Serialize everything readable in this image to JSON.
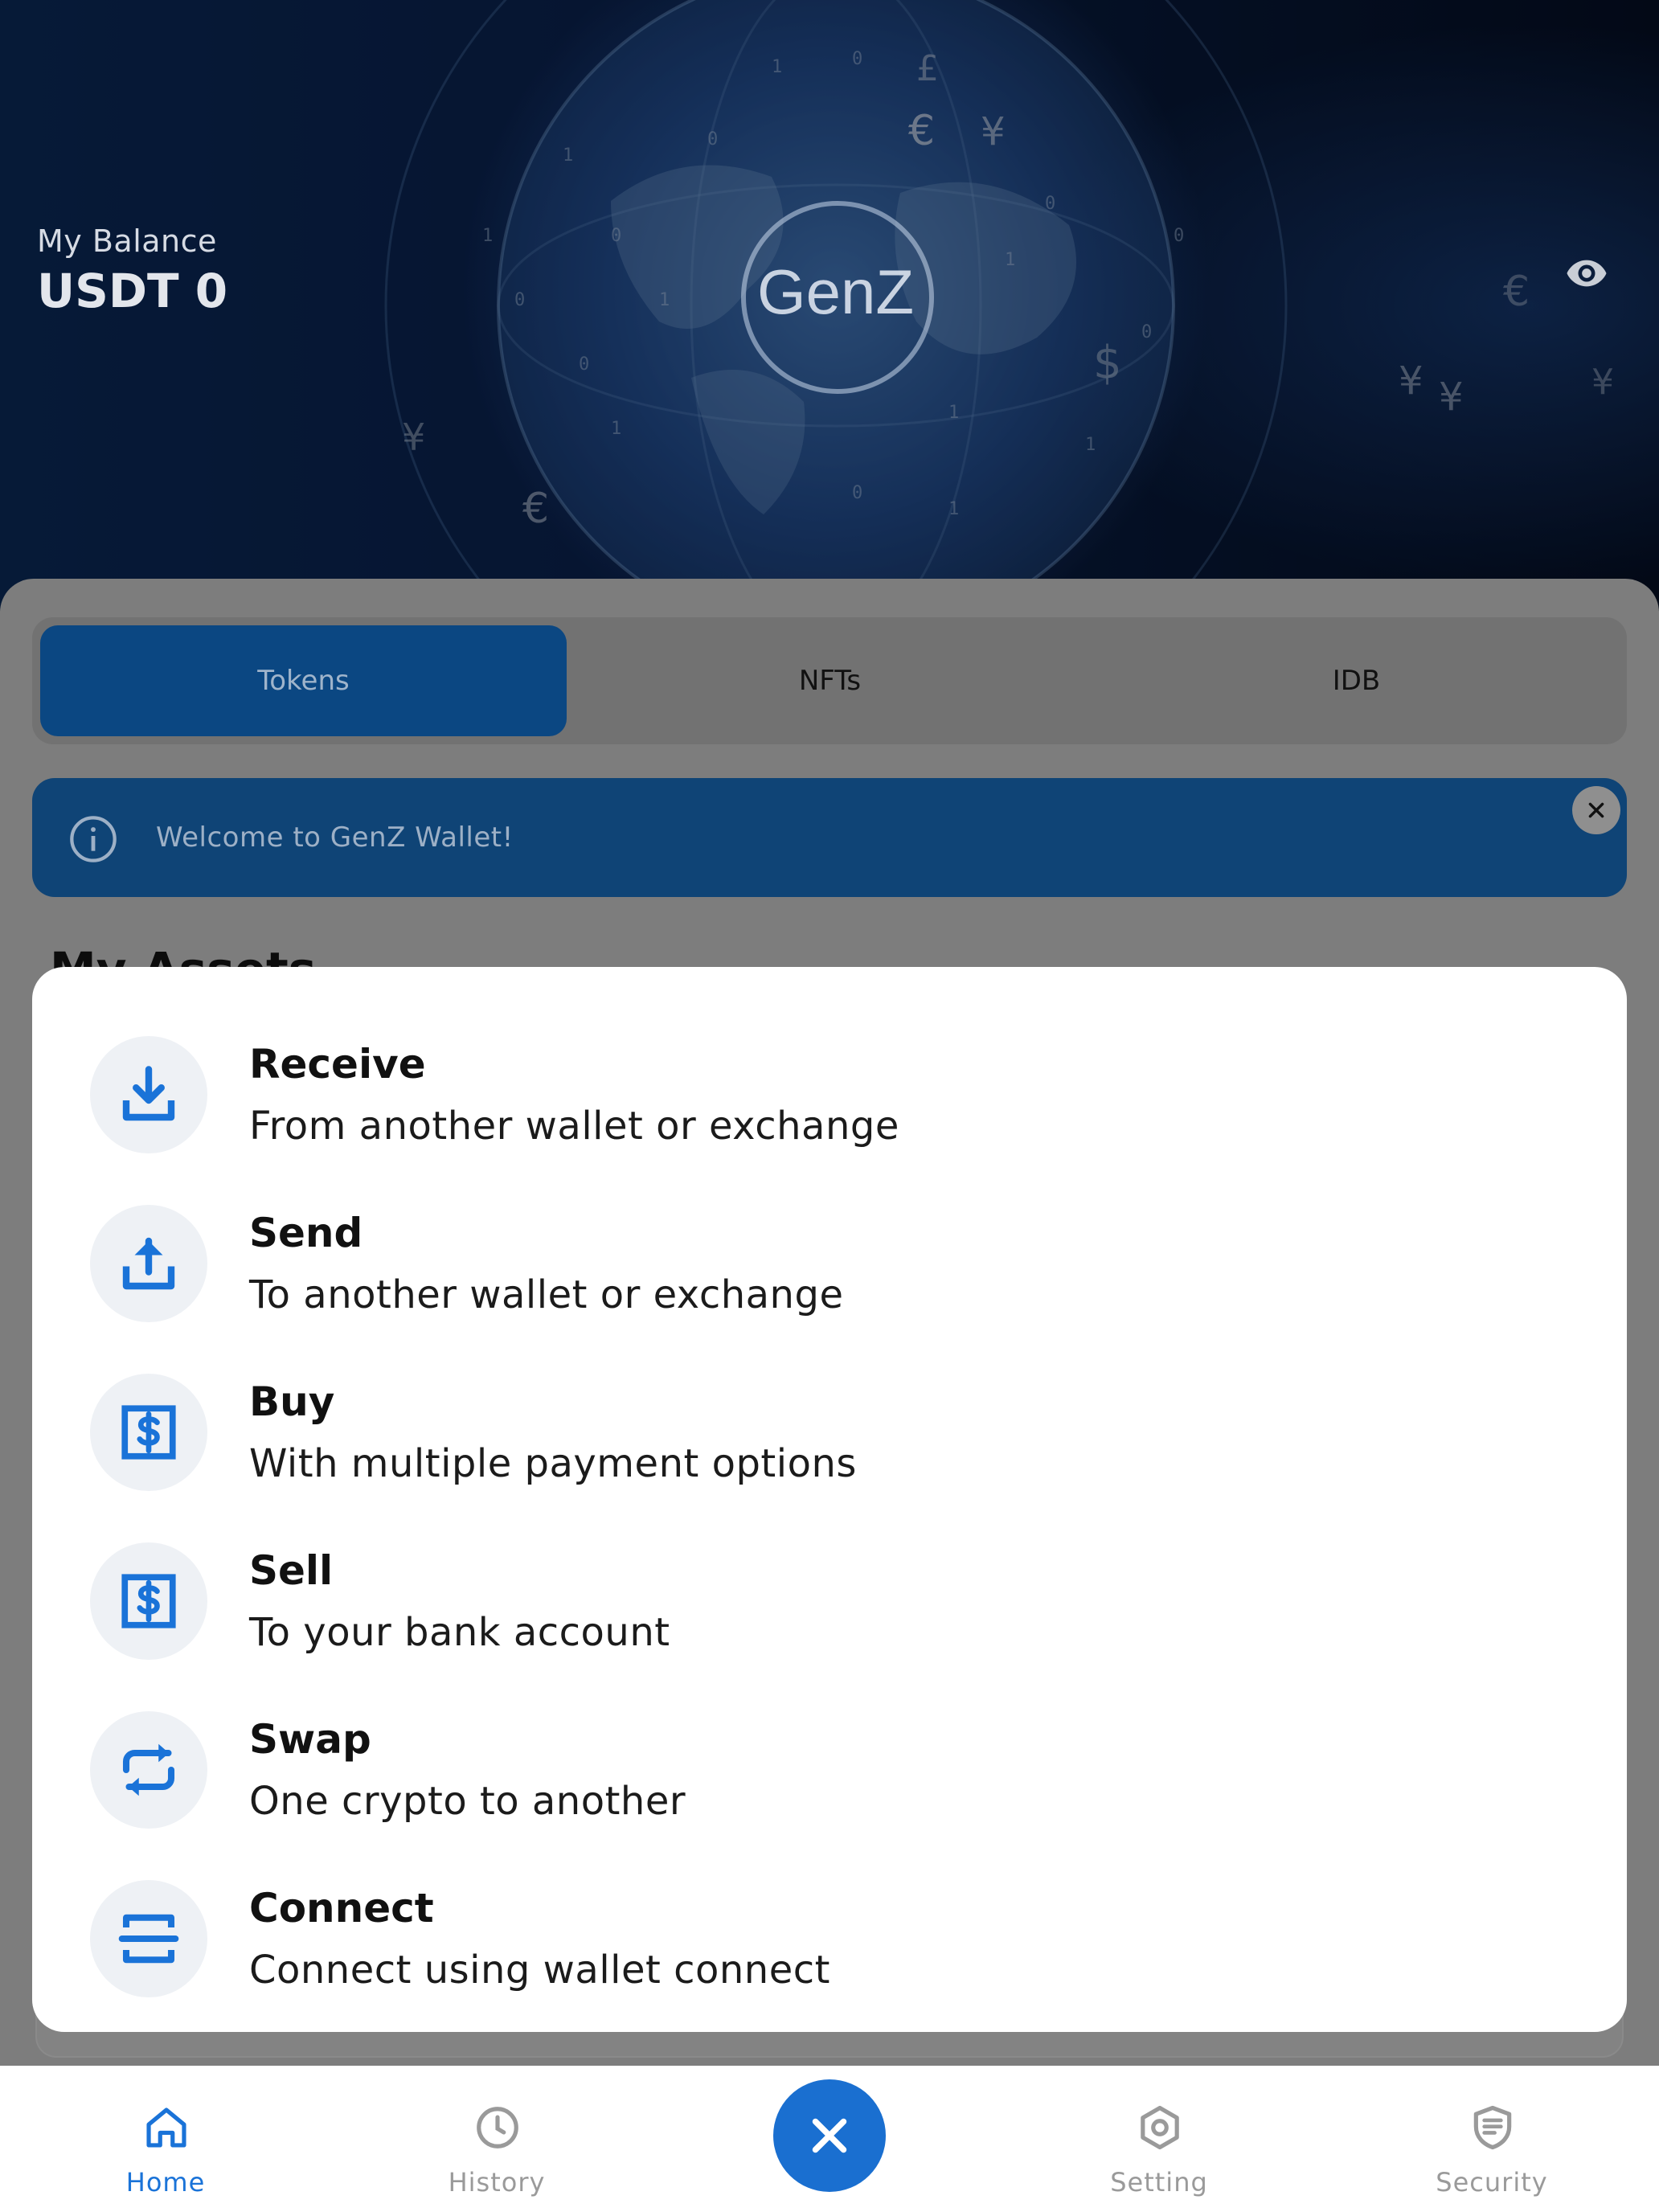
{
  "header": {
    "balance_label": "My Balance",
    "balance_value": "USDT 0",
    "logo_text": "GenZ"
  },
  "tabs": [
    {
      "label": "Tokens",
      "active": true
    },
    {
      "label": "NFTs",
      "active": false
    },
    {
      "label": "IDB",
      "active": false
    }
  ],
  "banner": {
    "text": "Welcome to GenZ Wallet!"
  },
  "assets": {
    "title": "My Assets"
  },
  "actions": [
    {
      "title": "Receive",
      "subtitle": "From another wallet or exchange",
      "icon": "download-icon"
    },
    {
      "title": "Send",
      "subtitle": "To another wallet or exchange",
      "icon": "upload-icon"
    },
    {
      "title": "Buy",
      "subtitle": "With multiple payment options",
      "icon": "dollar-icon"
    },
    {
      "title": "Sell",
      "subtitle": "To your bank account",
      "icon": "dollar-icon"
    },
    {
      "title": "Swap",
      "subtitle": "One crypto to another",
      "icon": "swap-icon"
    },
    {
      "title": "Connect",
      "subtitle": "Connect using wallet connect",
      "icon": "scan-icon"
    }
  ],
  "nav": [
    {
      "label": "Home",
      "icon": "home-icon",
      "active": true
    },
    {
      "label": "History",
      "icon": "clock-icon",
      "active": false
    },
    {
      "label": "Setting",
      "icon": "settings-icon",
      "active": false
    },
    {
      "label": "Security",
      "icon": "shield-icon",
      "active": false
    }
  ],
  "colors": {
    "primary": "#1a6fd0",
    "active_tab": "#0b4782",
    "banner": "#0f4476",
    "icon_blue": "#1a73d8"
  }
}
